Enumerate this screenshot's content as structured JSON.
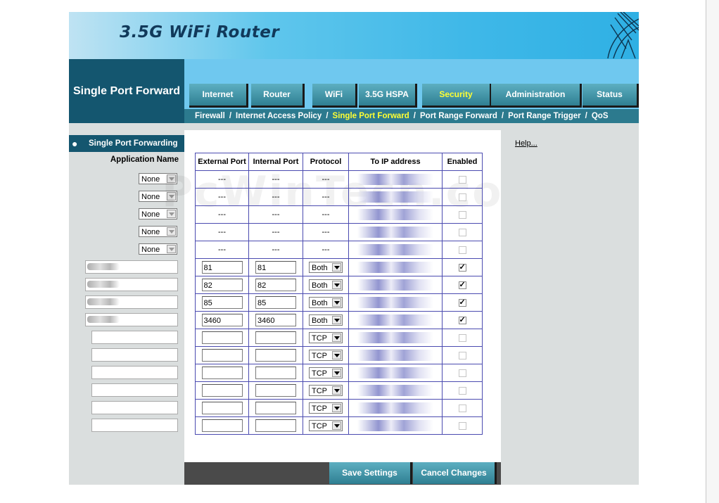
{
  "header": {
    "banner_title": "3.5G WiFi Router",
    "section_title": "Single Port Forward"
  },
  "tabs": [
    {
      "label": "Internet",
      "active": false
    },
    {
      "label": "Router",
      "active": false
    },
    {
      "label": "WiFi",
      "active": false
    },
    {
      "label": "3.5G HSPA",
      "active": false
    },
    {
      "label": "Security",
      "active": true
    },
    {
      "label": "Administration",
      "active": false
    },
    {
      "label": "Status",
      "active": false
    }
  ],
  "subnav": [
    {
      "label": "Firewall",
      "active": false
    },
    {
      "label": "Internet Access Policy",
      "active": false
    },
    {
      "label": "Single Port Forward",
      "active": true
    },
    {
      "label": "Port Range Forward",
      "active": false
    },
    {
      "label": "Port Range Trigger",
      "active": false
    },
    {
      "label": "QoS",
      "active": false
    }
  ],
  "sidebar": {
    "title": "Single Port Forwarding",
    "app_name_label": "Application Name",
    "app_selects": [
      "None",
      "None",
      "None",
      "None",
      "None"
    ]
  },
  "table": {
    "headers": [
      "External Port",
      "Internal Port",
      "Protocol",
      "To IP address",
      "Enabled"
    ],
    "rows": [
      {
        "type": "fixed",
        "ext": "---",
        "int": "---",
        "proto": "---",
        "enabled": false
      },
      {
        "type": "fixed",
        "ext": "---",
        "int": "---",
        "proto": "---",
        "enabled": false
      },
      {
        "type": "fixed",
        "ext": "---",
        "int": "---",
        "proto": "---",
        "enabled": false
      },
      {
        "type": "fixed",
        "ext": "---",
        "int": "---",
        "proto": "---",
        "enabled": false
      },
      {
        "type": "fixed",
        "ext": "---",
        "int": "---",
        "proto": "---",
        "enabled": false
      },
      {
        "type": "edit",
        "ext": "81",
        "int": "81",
        "proto": "Both",
        "enabled": true
      },
      {
        "type": "edit",
        "ext": "82",
        "int": "82",
        "proto": "Both",
        "enabled": true
      },
      {
        "type": "edit",
        "ext": "85",
        "int": "85",
        "proto": "Both",
        "enabled": true
      },
      {
        "type": "edit",
        "ext": "3460",
        "int": "3460",
        "proto": "Both",
        "enabled": true
      },
      {
        "type": "edit",
        "ext": "",
        "int": "",
        "proto": "TCP",
        "enabled": false
      },
      {
        "type": "edit",
        "ext": "",
        "int": "",
        "proto": "TCP",
        "enabled": false
      },
      {
        "type": "edit",
        "ext": "",
        "int": "",
        "proto": "TCP",
        "enabled": false
      },
      {
        "type": "edit",
        "ext": "",
        "int": "",
        "proto": "TCP",
        "enabled": false
      },
      {
        "type": "edit",
        "ext": "",
        "int": "",
        "proto": "TCP",
        "enabled": false
      },
      {
        "type": "edit",
        "ext": "",
        "int": "",
        "proto": "TCP",
        "enabled": false
      }
    ]
  },
  "help": {
    "label": "Help..."
  },
  "buttons": {
    "save": "Save Settings",
    "cancel": "Cancel Changes"
  },
  "watermark": "PcWinTech.com",
  "colors": {
    "nav_dark": "#14566f",
    "nav_light": "#6fc8ef",
    "active_tab_text": "#ffff33",
    "table_border": "#4b4bb0",
    "panel_gray": "#dadede"
  }
}
